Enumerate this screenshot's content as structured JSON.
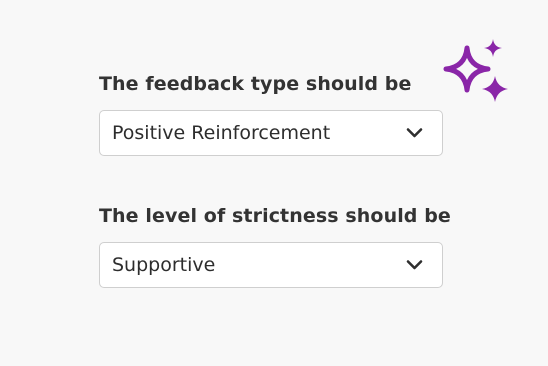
{
  "form": {
    "feedback_type": {
      "label": "The feedback type should be",
      "selected": "Positive Reinforcement"
    },
    "strictness": {
      "label": "The level of strictness should be",
      "selected": "Supportive"
    }
  },
  "icons": {
    "sparkle": "sparkles-icon",
    "dropdown": "chevron-down-icon"
  },
  "colors": {
    "accent": "#8a26a8",
    "background": "#f8f8f8",
    "text": "#333333",
    "border": "#cfcfcf"
  }
}
